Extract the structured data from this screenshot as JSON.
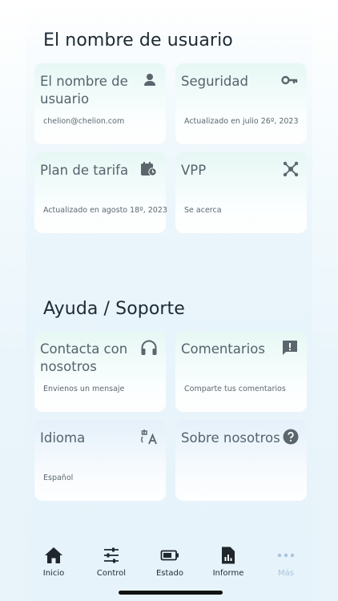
{
  "sections": [
    {
      "title": "El nombre de usuario",
      "cards": [
        {
          "title": "El nombre de usuario",
          "subtitle": "chelion@chelion.com",
          "icon": "user-icon"
        },
        {
          "title": "Seguridad",
          "subtitle": "Actualizado en julio 26º, 2023",
          "icon": "key-icon"
        },
        {
          "title": "Plan de tarifa",
          "subtitle": "Actualizado en agosto 18º, 2023",
          "icon": "calendar-clock-icon"
        },
        {
          "title": "VPP",
          "subtitle": "Se acerca",
          "icon": "network-icon"
        }
      ]
    },
    {
      "title": "Ayuda / Soporte",
      "cards": [
        {
          "title": "Contacta con nosotros",
          "subtitle": "Envienos un mensaje",
          "icon": "headphones-icon"
        },
        {
          "title": "Comentarios",
          "subtitle": "Comparte tus comentarios",
          "icon": "feedback-icon"
        },
        {
          "title": "Idioma",
          "subtitle": "Español",
          "icon": "translate-icon"
        },
        {
          "title": "Sobre nosotros",
          "subtitle": "",
          "icon": "help-icon"
        }
      ]
    }
  ],
  "nav": [
    {
      "label": "Inicio",
      "icon": "home-icon"
    },
    {
      "label": "Control",
      "icon": "sliders-icon"
    },
    {
      "label": "Estado",
      "icon": "battery-icon"
    },
    {
      "label": "Informe",
      "icon": "report-icon"
    },
    {
      "label": "Más",
      "icon": "more-icon",
      "active": true
    }
  ],
  "colors": {
    "text_dark": "#1d2a33",
    "card_title": "#55636c",
    "icon": "#5a656c",
    "nav_active": "#a9c4dc"
  }
}
